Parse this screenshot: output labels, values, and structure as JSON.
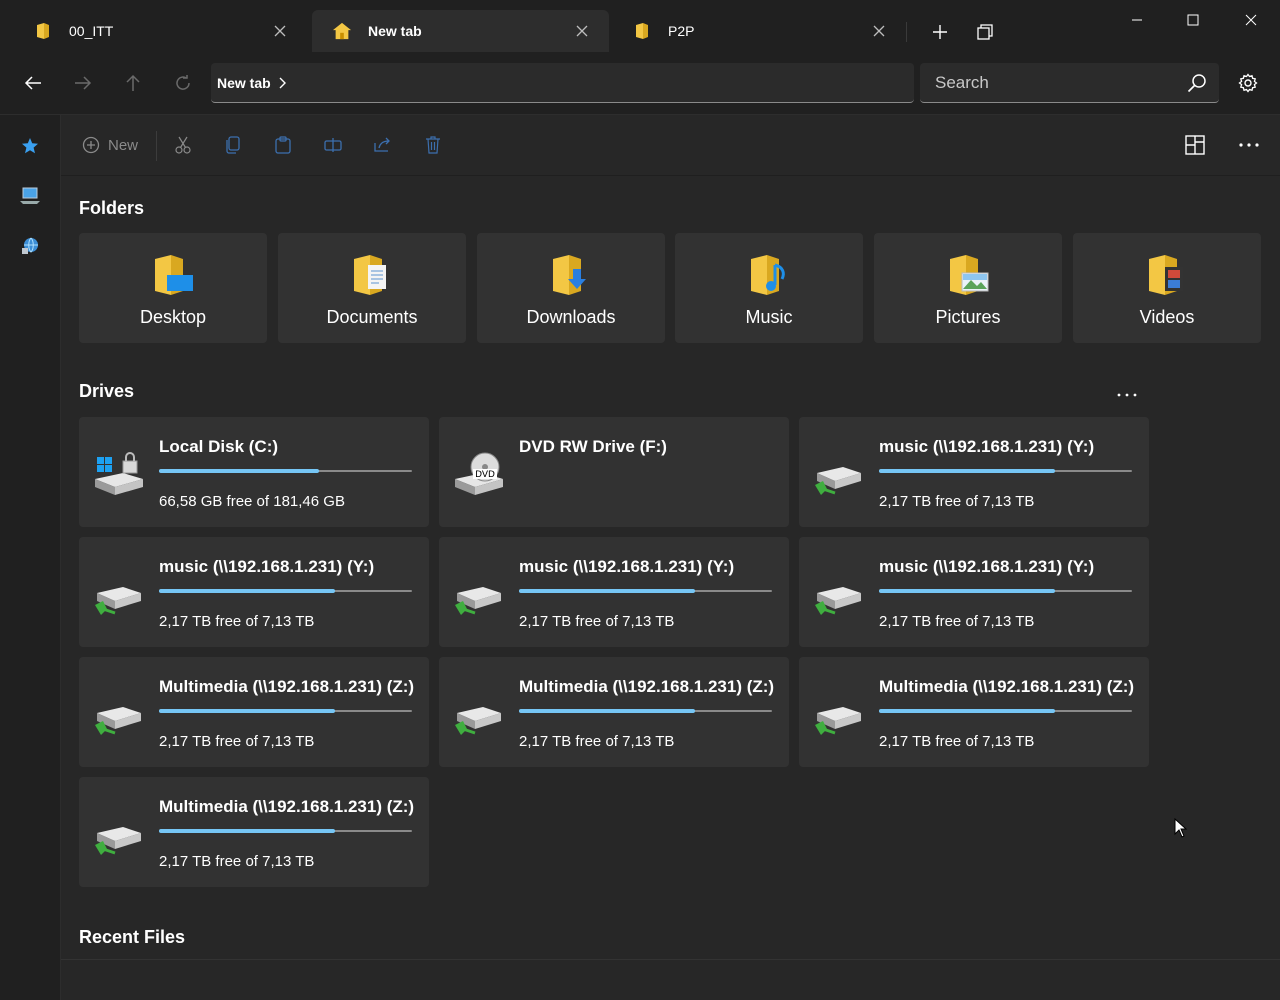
{
  "tabs": [
    {
      "label": "00_ITT",
      "icon": "folder-icon",
      "active": false
    },
    {
      "label": "New tab",
      "icon": "home-icon",
      "active": true
    },
    {
      "label": "P2P",
      "icon": "folder-icon",
      "active": false
    }
  ],
  "address": {
    "breadcrumb": "New tab",
    "search_placeholder": "Search"
  },
  "toolbar": {
    "new_label": "New"
  },
  "sections": {
    "folders": "Folders",
    "drives": "Drives",
    "recent": "Recent Files"
  },
  "folders": [
    {
      "label": "Desktop",
      "icon": "desktop-folder-icon"
    },
    {
      "label": "Documents",
      "icon": "documents-folder-icon"
    },
    {
      "label": "Downloads",
      "icon": "downloads-folder-icon"
    },
    {
      "label": "Music",
      "icon": "music-folder-icon"
    },
    {
      "label": "Pictures",
      "icon": "pictures-folder-icon"
    },
    {
      "label": "Videos",
      "icon": "videos-folder-icon"
    }
  ],
  "drives": [
    {
      "name": "Local Disk (C:)",
      "free": "66,58 GB free of 181,46 GB",
      "used_fraction": 0.633,
      "icon": "local-disk-icon"
    },
    {
      "name": "DVD RW Drive (F:)",
      "free": "",
      "used_fraction": null,
      "icon": "dvd-drive-icon"
    },
    {
      "name": "music (\\\\192.168.1.231) (Y:)",
      "free": "2,17 TB free of 7,13 TB",
      "used_fraction": 0.696,
      "icon": "network-drive-icon"
    },
    {
      "name": "music (\\\\192.168.1.231) (Y:)",
      "free": "2,17 TB free of 7,13 TB",
      "used_fraction": 0.696,
      "icon": "network-drive-icon"
    },
    {
      "name": "music (\\\\192.168.1.231) (Y:)",
      "free": "2,17 TB free of 7,13 TB",
      "used_fraction": 0.696,
      "icon": "network-drive-icon"
    },
    {
      "name": "music (\\\\192.168.1.231) (Y:)",
      "free": "2,17 TB free of 7,13 TB",
      "used_fraction": 0.696,
      "icon": "network-drive-icon"
    },
    {
      "name": "Multimedia (\\\\192.168.1.231) (Z:)",
      "free": "2,17 TB free of 7,13 TB",
      "used_fraction": 0.696,
      "icon": "network-drive-icon"
    },
    {
      "name": "Multimedia (\\\\192.168.1.231) (Z:)",
      "free": "2,17 TB free of 7,13 TB",
      "used_fraction": 0.696,
      "icon": "network-drive-icon"
    },
    {
      "name": "Multimedia (\\\\192.168.1.231) (Z:)",
      "free": "2,17 TB free of 7,13 TB",
      "used_fraction": 0.696,
      "icon": "network-drive-icon"
    },
    {
      "name": "Multimedia (\\\\192.168.1.231) (Z:)",
      "free": "2,17 TB free of 7,13 TB",
      "used_fraction": 0.696,
      "icon": "network-drive-icon"
    }
  ],
  "colors": {
    "accent": "#76c6f5",
    "background": "#202020",
    "card": "#323232",
    "folder_yellow": "#f3c744"
  }
}
